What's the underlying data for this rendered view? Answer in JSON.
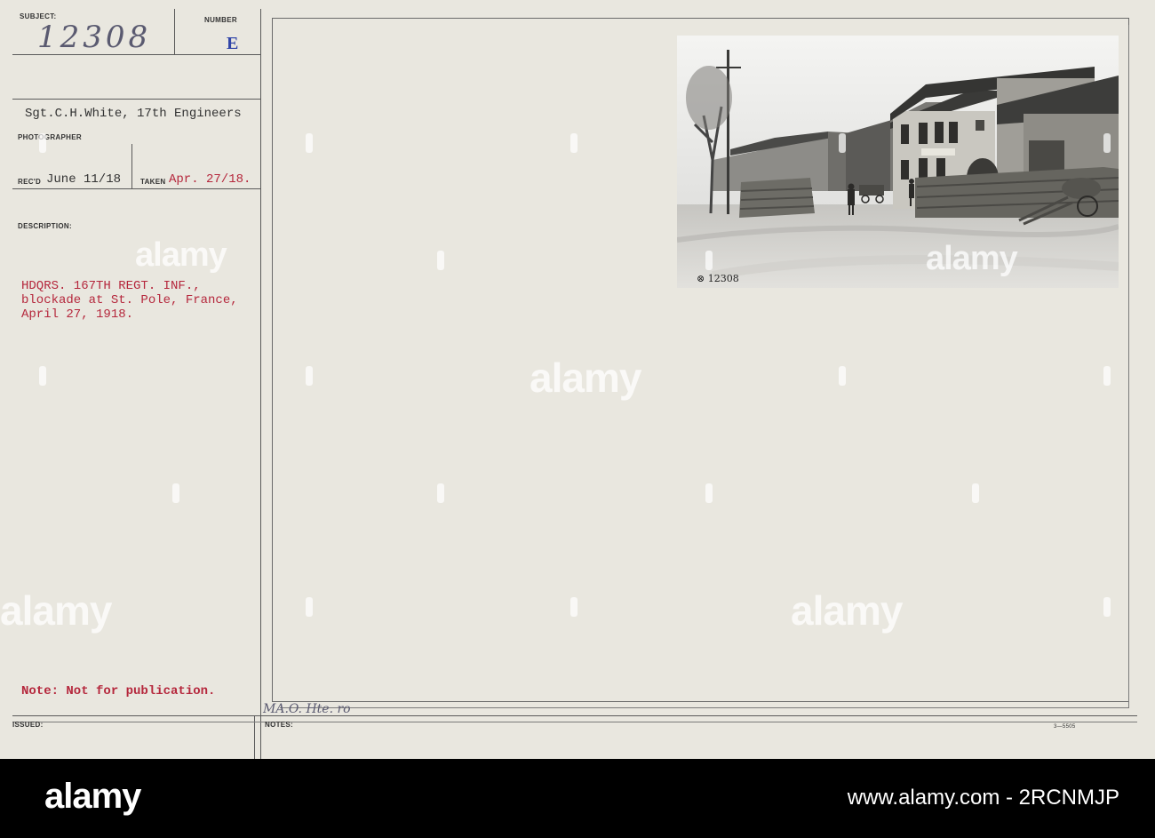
{
  "card": {
    "subject_label": "SUBJECT:",
    "subject_value": "12308",
    "number_label": "NUMBER",
    "number_value": "E",
    "photographer_value": "Sgt.C.H.White, 17th Engineers",
    "photographer_label": "PHOTOGRAPHER",
    "recd_label": "REC'D",
    "recd_value": "June 11/18",
    "taken_label": "TAKEN",
    "taken_value": "Apr. 27/18.",
    "description_label": "DESCRIPTION:",
    "description_lines": [
      "HDQRS. 167TH REGT. INF.,",
      "blockade at St. Pole, France,",
      "April 27, 1918."
    ],
    "note": "Note: Not for publication.",
    "issued_label": "ISSUED:",
    "notes_label": "NOTES:",
    "handwritten_note": "MA.O. Hte. ro",
    "form_number": "3—5505"
  },
  "photo": {
    "caption": "12308",
    "description": "WWI street scene in St. Pole, France, with a stone blockade, village houses and soldiers"
  },
  "watermark": {
    "text": "alamy"
  },
  "footer": {
    "logo": "alamy",
    "image_id": "www.alamy.com - 2RCNMJP"
  }
}
